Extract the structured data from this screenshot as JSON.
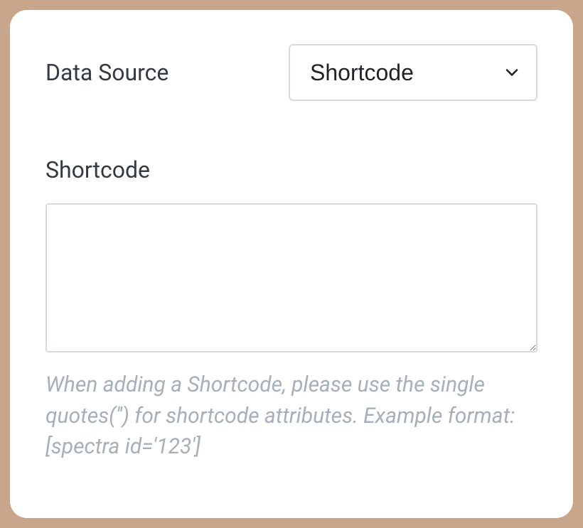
{
  "dataSource": {
    "label": "Data Source",
    "selected": "Shortcode"
  },
  "shortcode": {
    "label": "Shortcode",
    "value": "",
    "helper": "When adding a Shortcode, please use the single quotes('') for shortcode attributes. Example format: [spectra id='123']"
  }
}
